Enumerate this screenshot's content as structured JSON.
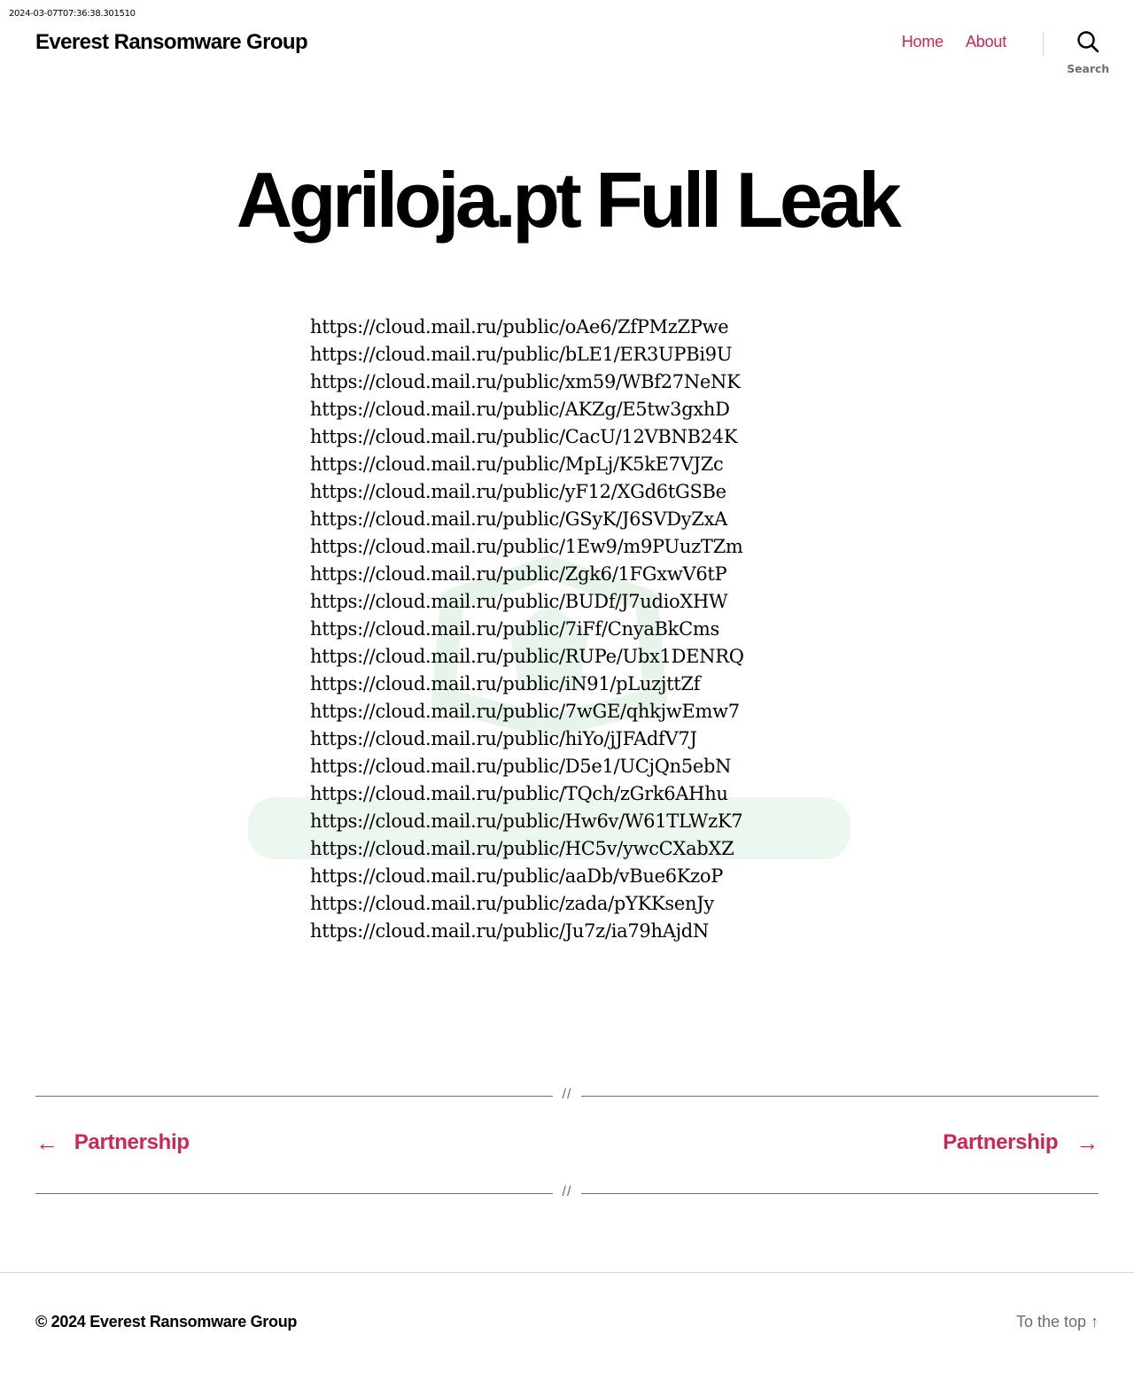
{
  "timestamp": "2024-03-07T07:36:38.301510",
  "header": {
    "site_title": "Everest Ransomware Group",
    "nav": [
      {
        "label": "Home"
      },
      {
        "label": "About"
      }
    ],
    "search_label": "Search",
    "search_icon": "search-icon"
  },
  "post": {
    "title": "Agriloja.pt Full Leak",
    "links": [
      "https://cloud.mail.ru/public/oAe6/ZfPMzZPwe",
      "https://cloud.mail.ru/public/bLE1/ER3UPBi9U",
      "https://cloud.mail.ru/public/xm59/WBf27NeNK",
      "https://cloud.mail.ru/public/AKZg/E5tw3gxhD",
      "https://cloud.mail.ru/public/CacU/12VBNB24K",
      "https://cloud.mail.ru/public/MpLj/K5kE7VJZc",
      "https://cloud.mail.ru/public/yF12/XGd6tGSBe",
      "https://cloud.mail.ru/public/GSyK/J6SVDyZxA",
      "https://cloud.mail.ru/public/1Ew9/m9PUuzTZm",
      "https://cloud.mail.ru/public/Zgk6/1FGxwV6tP",
      "https://cloud.mail.ru/public/BUDf/J7udioXHW",
      "https://cloud.mail.ru/public/7iFf/CnyaBkCms",
      "https://cloud.mail.ru/public/RUPe/Ubx1DENRQ",
      "https://cloud.mail.ru/public/iN91/pLuzjttZf",
      "https://cloud.mail.ru/public/7wGE/qhkjwEmw7",
      "https://cloud.mail.ru/public/hiYo/jJFAdfV7J",
      "https://cloud.mail.ru/public/D5e1/UCjQn5ebN",
      "https://cloud.mail.ru/public/TQch/zGrk6AHhu",
      "https://cloud.mail.ru/public/Hw6v/W61TLWzK7",
      "https://cloud.mail.ru/public/HC5v/ywcCXabXZ",
      "https://cloud.mail.ru/public/aaDb/vBue6KzoP",
      "https://cloud.mail.ru/public/zada/pYKKsenJy",
      "https://cloud.mail.ru/public/Ju7z/ia79hAjdN"
    ],
    "watermark_color": "#e6f4ea"
  },
  "separators": {
    "glyph": "//"
  },
  "post_navigation": {
    "prev_label": "Partnership",
    "next_label": "Partnership",
    "prev_arrow": "←",
    "next_arrow": "→"
  },
  "footer": {
    "copyright": "© 2024 Everest Ransomware Group",
    "to_top": "To the top ↑"
  },
  "colors": {
    "accent": "#cd2653",
    "muted": "#6d6d6d",
    "text": "#000000",
    "background": "#ffffff"
  }
}
